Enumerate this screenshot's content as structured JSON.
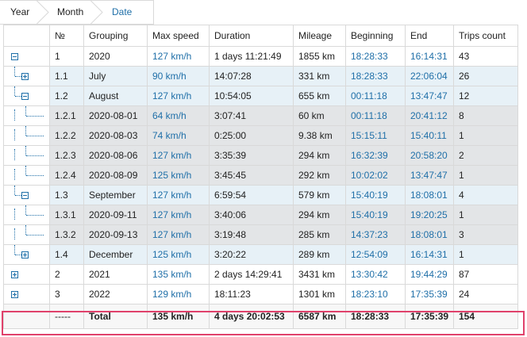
{
  "breadcrumb": [
    "Year",
    "Month",
    "Date"
  ],
  "columns": [
    "",
    "№",
    "Grouping",
    "Max speed",
    "Duration",
    "Mileage",
    "Beginning",
    "End",
    "Trips count"
  ],
  "rows": [
    {
      "num": "1",
      "grouping": "2020",
      "max_speed": "127 km/h",
      "duration": "1 days 11:21:49",
      "mileage": "1855 km",
      "beginning": "18:28:33",
      "end": "16:14:31",
      "trips": "43"
    },
    {
      "num": "1.1",
      "grouping": "July",
      "max_speed": "90 km/h",
      "duration": "14:07:28",
      "mileage": "331 km",
      "beginning": "18:28:33",
      "end": "22:06:04",
      "trips": "26"
    },
    {
      "num": "1.2",
      "grouping": "August",
      "max_speed": "127 km/h",
      "duration": "10:54:05",
      "mileage": "655 km",
      "beginning": "00:11:18",
      "end": "13:47:47",
      "trips": "12"
    },
    {
      "num": "1.2.1",
      "grouping": "2020-08-01",
      "max_speed": "64 km/h",
      "duration": "3:07:41",
      "mileage": "60 km",
      "beginning": "00:11:18",
      "end": "20:41:12",
      "trips": "8"
    },
    {
      "num": "1.2.2",
      "grouping": "2020-08-03",
      "max_speed": "74 km/h",
      "duration": "0:25:00",
      "mileage": "9.38 km",
      "beginning": "15:15:11",
      "end": "15:40:11",
      "trips": "1"
    },
    {
      "num": "1.2.3",
      "grouping": "2020-08-06",
      "max_speed": "127 km/h",
      "duration": "3:35:39",
      "mileage": "294 km",
      "beginning": "16:32:39",
      "end": "20:58:20",
      "trips": "2"
    },
    {
      "num": "1.2.4",
      "grouping": "2020-08-09",
      "max_speed": "125 km/h",
      "duration": "3:45:45",
      "mileage": "292 km",
      "beginning": "10:02:02",
      "end": "13:47:47",
      "trips": "1"
    },
    {
      "num": "1.3",
      "grouping": "September",
      "max_speed": "127 km/h",
      "duration": "6:59:54",
      "mileage": "579 km",
      "beginning": "15:40:19",
      "end": "18:08:01",
      "trips": "4"
    },
    {
      "num": "1.3.1",
      "grouping": "2020-09-11",
      "max_speed": "127 km/h",
      "duration": "3:40:06",
      "mileage": "294 km",
      "beginning": "15:40:19",
      "end": "19:20:25",
      "trips": "1"
    },
    {
      "num": "1.3.2",
      "grouping": "2020-09-13",
      "max_speed": "127 km/h",
      "duration": "3:19:48",
      "mileage": "285 km",
      "beginning": "14:37:23",
      "end": "18:08:01",
      "trips": "3"
    },
    {
      "num": "1.4",
      "grouping": "December",
      "max_speed": "125 km/h",
      "duration": "3:20:22",
      "mileage": "289 km",
      "beginning": "12:54:09",
      "end": "16:14:31",
      "trips": "1"
    },
    {
      "num": "2",
      "grouping": "2021",
      "max_speed": "135 km/h",
      "duration": "2 days 14:29:41",
      "mileage": "3431 km",
      "beginning": "13:30:42",
      "end": "19:44:29",
      "trips": "87"
    },
    {
      "num": "3",
      "grouping": "2022",
      "max_speed": "129 km/h",
      "duration": "18:11:23",
      "mileage": "1301 km",
      "beginning": "18:23:10",
      "end": "17:35:39",
      "trips": "24"
    }
  ],
  "total": {
    "num": "-----",
    "grouping": "Total",
    "max_speed": "135 km/h",
    "duration": "4 days 20:02:53",
    "mileage": "6587 km",
    "beginning": "18:28:33",
    "end": "17:35:39",
    "trips": "154"
  }
}
